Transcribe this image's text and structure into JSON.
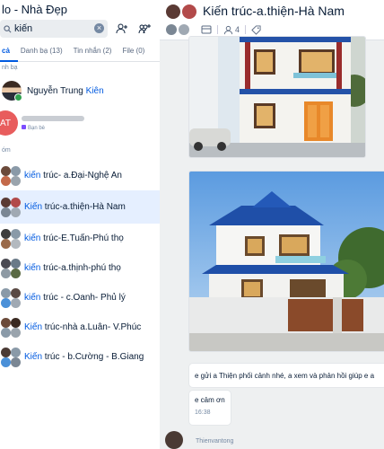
{
  "window": {
    "title": "lo - Nhà Đẹp"
  },
  "search": {
    "value": "kiến"
  },
  "tabs": [
    {
      "label": "cả"
    },
    {
      "label": "Danh bạ (13)"
    },
    {
      "label": "Tin nhắn (2)"
    },
    {
      "label": "File (0)"
    }
  ],
  "sections": {
    "contacts": "nh bạ",
    "groups": "óm"
  },
  "contacts": [
    {
      "name_prefix": "Nguyễn Trung ",
      "name_highlight": "Kiên",
      "sub": ""
    },
    {
      "initials": "AT",
      "name_prefix": "",
      "name_highlight": "",
      "sub": "Bạn bè"
    }
  ],
  "groups": [
    {
      "hl": "kiến",
      "rest": " trúc- a.Đại-Nghệ An"
    },
    {
      "hl": "Kiến",
      "rest": " trúc-a.thiện-Hà Nam"
    },
    {
      "hl": "kiến",
      "rest": " trúc-E.Tuấn-Phú thọ"
    },
    {
      "hl": "kiến",
      "rest": " trúc-a.thịnh-phú thọ"
    },
    {
      "hl": "kiến",
      "rest": " trúc - c.Oanh- Phủ lý"
    },
    {
      "hl": "Kiến",
      "rest": " trúc-nhà a.Luân- V.Phúc"
    },
    {
      "hl": "Kiến",
      "rest": " trúc - b.Cường - B.Giang"
    }
  ],
  "chat": {
    "title": "Kiến trúc-a.thiện-Hà Nam",
    "member_count": "4",
    "messages": [
      {
        "text": "e gửi a Thiện phối cảnh nhé, a xem và phản hồi giúp e a"
      },
      {
        "text": "e cảm ơn",
        "time": "16:38"
      }
    ],
    "next_sender": "Thienvantong"
  },
  "colors": {
    "accent": "#005ae0",
    "selected": "#e5efff",
    "sky": "#4a8fd8",
    "roof": "#1f4fa8"
  }
}
